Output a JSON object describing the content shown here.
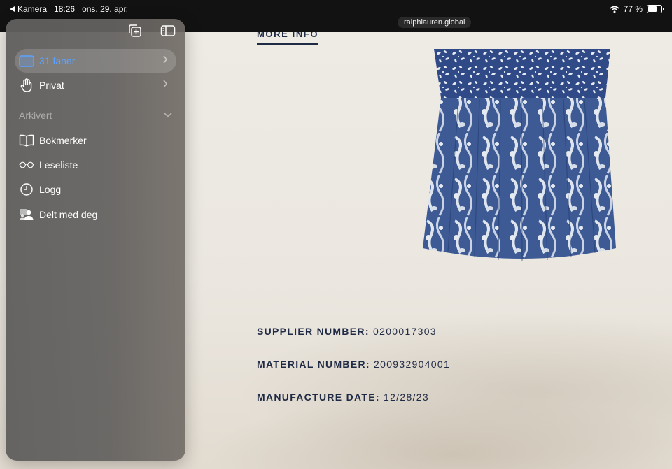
{
  "status_bar": {
    "back_label": "Kamera",
    "time": "18:26",
    "date": "ons. 29. apr.",
    "battery_text": "77 %",
    "battery_level": 0.77
  },
  "browser": {
    "url": "ralphlauren.global"
  },
  "sidebar": {
    "items_top": [
      {
        "label": "31 faner",
        "icon": "tabs-icon",
        "active": true
      },
      {
        "label": "Privat",
        "icon": "hand-icon",
        "active": false
      }
    ],
    "section_title": "Arkivert",
    "items": [
      {
        "label": "Bokmerker",
        "icon": "book-icon"
      },
      {
        "label": "Leseliste",
        "icon": "glasses-icon"
      },
      {
        "label": "Logg",
        "icon": "clock-icon"
      },
      {
        "label": "Delt med deg",
        "icon": "shared-icon"
      }
    ]
  },
  "page": {
    "tab_label": "MORE INFO",
    "details": [
      {
        "key": "SUPPLIER NUMBER:",
        "value": "0200017303"
      },
      {
        "key": "MATERIAL NUMBER:",
        "value": "200932904001"
      },
      {
        "key": "MANUFACTURE DATE:",
        "value": "12/28/23"
      }
    ]
  },
  "colors": {
    "accent_blue": "#5ba3ff",
    "navy_text": "#1f2a44",
    "skirt_blue": "#3d5a94"
  }
}
